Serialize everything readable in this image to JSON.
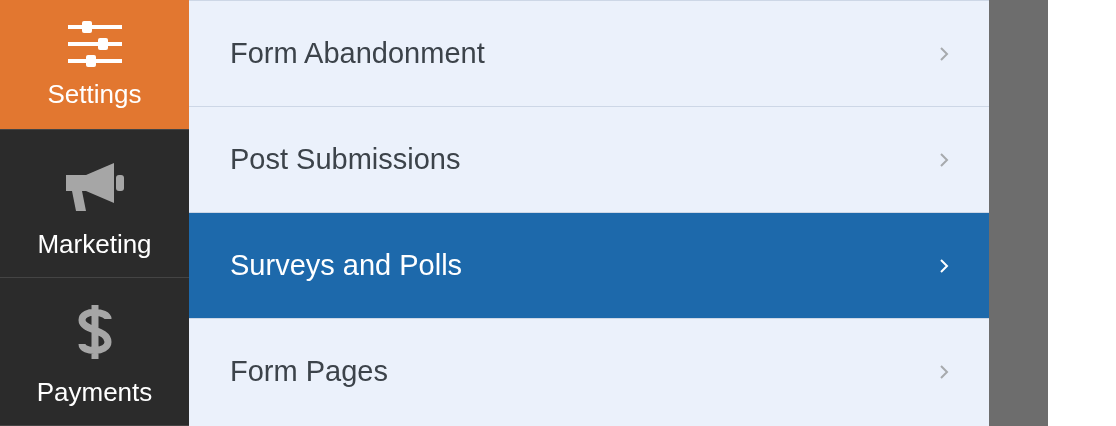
{
  "sidebar": {
    "items": [
      {
        "kind": "settings",
        "label": "Settings",
        "selected": true
      },
      {
        "kind": "marketing",
        "label": "Marketing",
        "selected": false
      },
      {
        "kind": "payments",
        "label": "Payments",
        "selected": false
      }
    ]
  },
  "panel": {
    "items": [
      {
        "label": "Form Abandonment",
        "selected": false
      },
      {
        "label": "Post Submissions",
        "selected": false
      },
      {
        "label": "Surveys and Polls",
        "selected": true
      },
      {
        "label": "Form Pages",
        "selected": false
      }
    ]
  }
}
